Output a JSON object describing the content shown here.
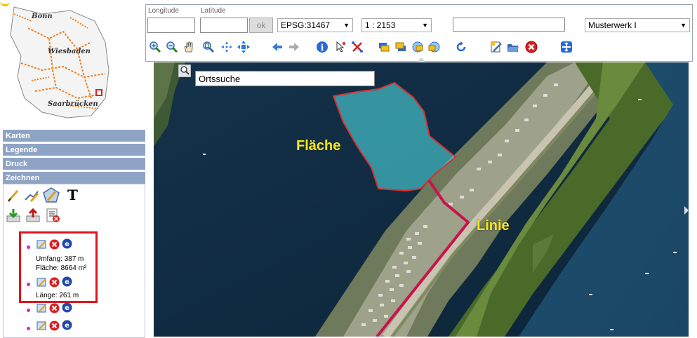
{
  "overview": {
    "cities": [
      "Bonn",
      "Wiesbaden",
      "Saarbrücken"
    ]
  },
  "sidebar": {
    "sections": [
      "Karten",
      "Legende",
      "Druck",
      "Zeichnen"
    ],
    "draw_text_tool": "T"
  },
  "results": [
    {
      "umfang": "Umfang: 387 m",
      "flaeche": "Fläche: 8664 m²"
    },
    {
      "laenge": "Länge: 261 m"
    }
  ],
  "toolbar": {
    "longitude_label": "Longitude",
    "latitude_label": "Latitude",
    "longitude_value": "",
    "latitude_value": "",
    "ok_label": "ok",
    "projection": "EPSG:31467",
    "scale": "1 : 2153",
    "free_field": "",
    "project": "Musterwerk I"
  },
  "map": {
    "search_value": "Ortssuche",
    "polygon_label": "Fläche",
    "line_label": "Linie"
  },
  "colors": {
    "accordion": "#8fa4c4",
    "highlight_border": "#e0141c",
    "polygon_fill": "#4fd8e0",
    "line": "#c8144c",
    "label_yellow": "#f5e61c"
  }
}
